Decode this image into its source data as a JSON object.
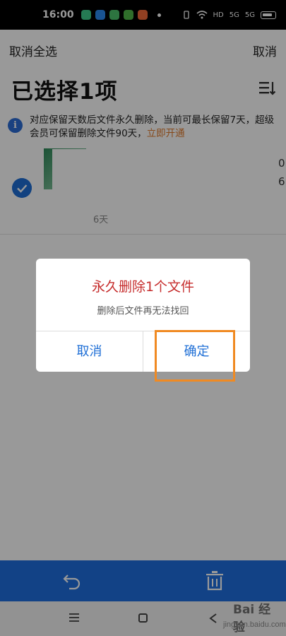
{
  "status_bar": {
    "time": "16:00",
    "network_badges": [
      "HD",
      "5G",
      "5G"
    ]
  },
  "header": {
    "cancel_select_all": "取消全选",
    "cancel": "取消",
    "title": "已选择1项"
  },
  "notice": {
    "text": "对应保留天数后文件永久删除，当前可最长保留7天，超级会员可保留删除文件90天，",
    "link": "立即开通"
  },
  "file": {
    "days": "6天",
    "trailing_fragments": [
      "0",
      "6"
    ]
  },
  "dialog": {
    "title": "永久删除1个文件",
    "message": "删除后文件再无法找回",
    "cancel_label": "取消",
    "confirm_label": "确定"
  },
  "watermark": {
    "logo": "Bai 经验",
    "url": "jingyan.baidu.com"
  },
  "colors": {
    "accent": "#1f6fd6",
    "danger": "#c62d2d",
    "highlight": "#f08a22",
    "link": "#e07a2c"
  }
}
